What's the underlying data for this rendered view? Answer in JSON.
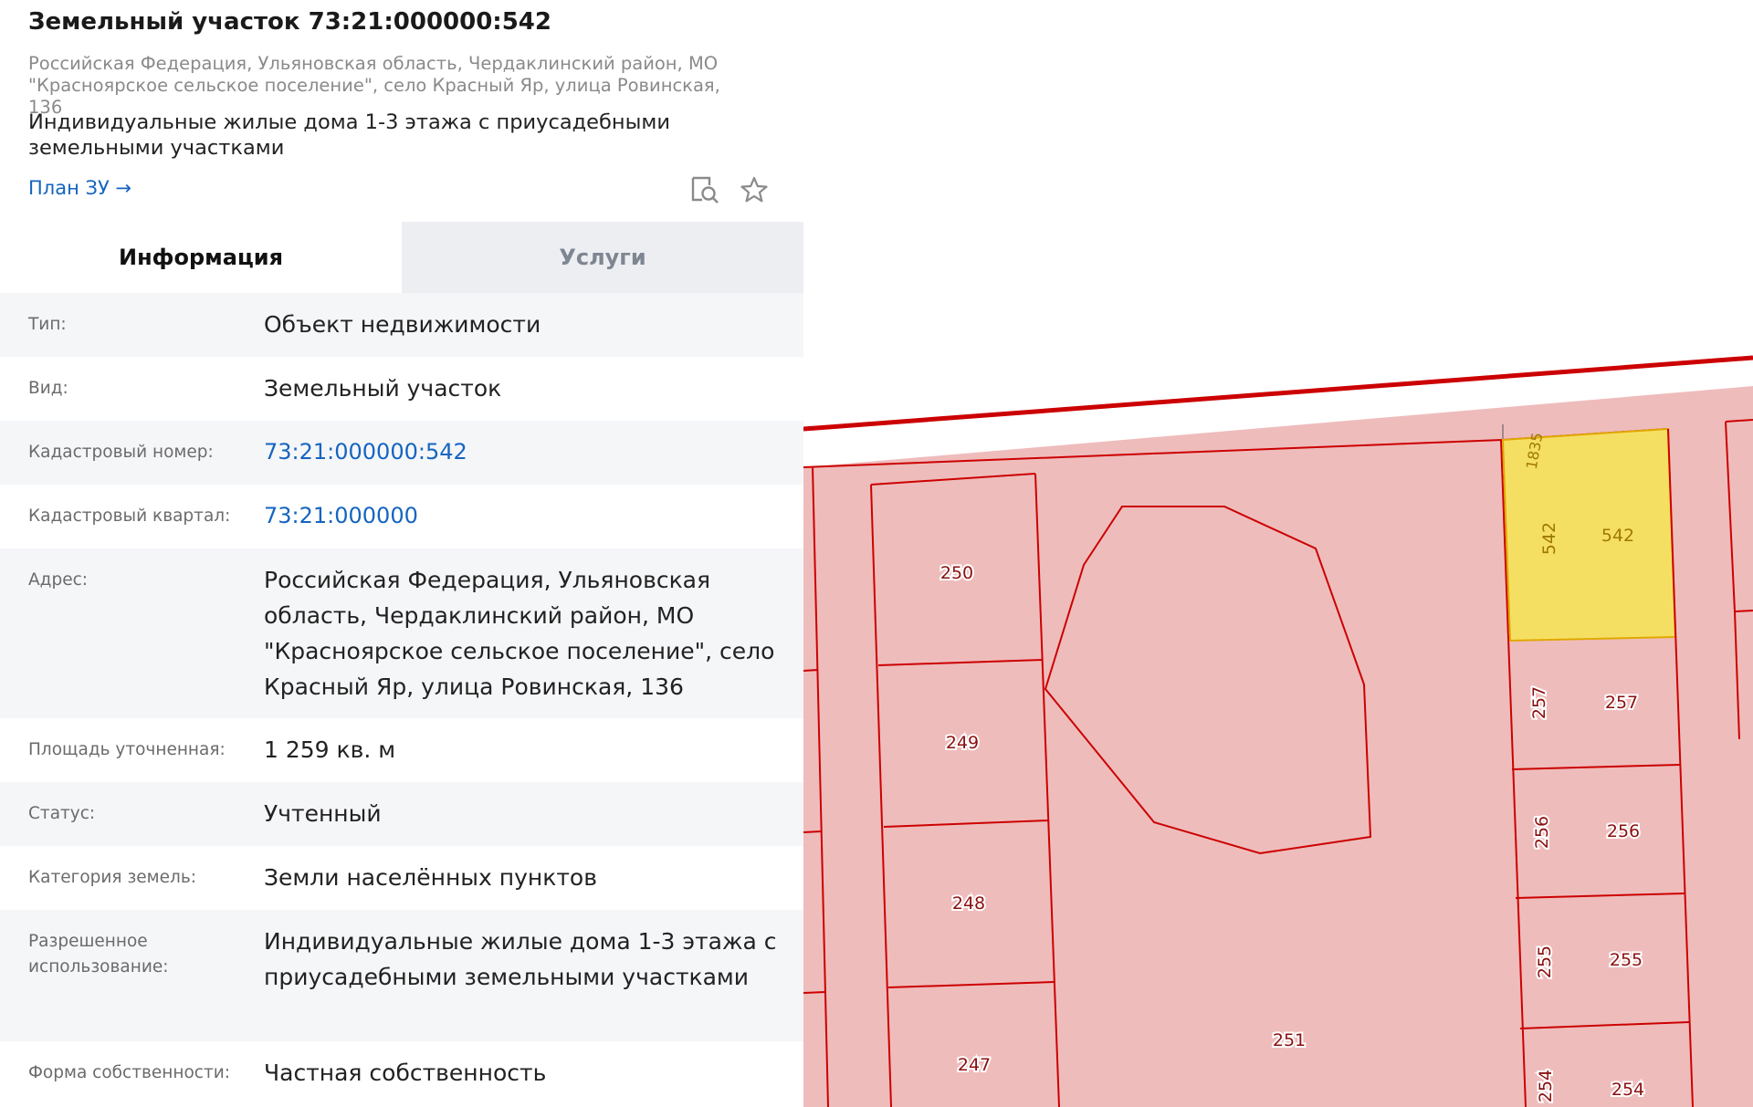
{
  "header": {
    "title": "Земельный участок 73:21:000000:542",
    "address": "Российская Федерация, Ульяновская область, Чердаклинский район, МО \"Красноярское сельское поселение\", село Красный Яр, улица Ровинская, 136",
    "use": "Индивидуальные жилые дома 1-3 этажа с приусадебными земельными участками",
    "plan_link": "План ЗУ →"
  },
  "tabs": [
    {
      "label": "Информация",
      "active": true
    },
    {
      "label": "Услуги",
      "active": false
    }
  ],
  "info": [
    {
      "label": "Тип:",
      "value": "Объект недвижимости"
    },
    {
      "label": "Вид:",
      "value": "Земельный участок"
    },
    {
      "label": "Кадастровый номер:",
      "value": "73:21:000000:542",
      "link": true
    },
    {
      "label": "Кадастровый квартал:",
      "value": "73:21:000000",
      "link": true
    },
    {
      "label": "Адрес:",
      "value": "Российская Федерация, Ульяновская область, Чердаклинский район, МО \"Красноярское сельское поселение\", село Красный Яр, улица Ровинская, 136"
    },
    {
      "label": "Площадь уточненная:",
      "value": "1 259 кв. м"
    },
    {
      "label": "Статус:",
      "value": "Учтенный"
    },
    {
      "label": "Категория земель:",
      "value": "Земли населённых пунктов"
    },
    {
      "label": "Разрешенное использование:",
      "value": "Индивидуальные жилые дома 1-3 этажа с приусадебными земельными участками"
    },
    {
      "label": "Форма собственности:",
      "value": "Частная собственность"
    }
  ],
  "icons": [
    "preview-search-icon",
    "star-icon"
  ],
  "map": {
    "labels": [
      "250",
      "249",
      "248",
      "247",
      "251",
      "1835",
      "542",
      "542",
      "257",
      "257",
      "256",
      "256",
      "255",
      "255",
      "254",
      "254"
    ],
    "colors": {
      "parcel_fill": "#efbcbc",
      "boundary": "#cc0000",
      "selected_fill": "#f5df63",
      "selected_border": "#e0a800"
    }
  },
  "colors": {
    "link": "#1565c0",
    "row_alt": "#f5f6f8",
    "tab_inactive": "#eceef2"
  }
}
